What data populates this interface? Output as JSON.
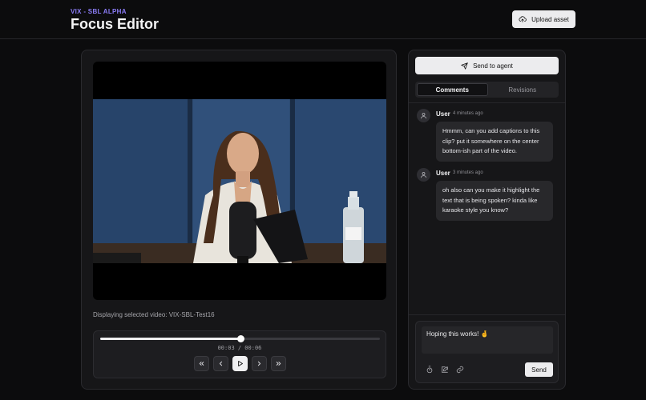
{
  "header": {
    "subtitle": "VIX - SBL ALPHA",
    "title": "Focus Editor",
    "upload_label": "Upload asset"
  },
  "video": {
    "caption": "Displaying selected video: VIX-SBL-Test16"
  },
  "player": {
    "time": "00:03 / 00:06",
    "progress": 0.5
  },
  "sidebar": {
    "send_agent_label": "Send to agent",
    "tabs": [
      {
        "label": "Comments",
        "active": true
      },
      {
        "label": "Revisions",
        "active": false
      }
    ],
    "comments": [
      {
        "user": "User",
        "time": "4 minutes ago",
        "text": "Hmmm, can you add captions to this clip? put it somewhere on the center bottom-ish part of the video."
      },
      {
        "user": "User",
        "time": "3 minutes ago",
        "text": "oh also can you make it highlight the text that is being spoken? kinda like karaoke style you know?"
      }
    ],
    "compose": {
      "text": "Hoping this works! 🤞",
      "send_label": "Send"
    }
  },
  "colors": {
    "accent": "#8b7cf6",
    "background": "#0c0c0d",
    "panel": "#161618"
  }
}
